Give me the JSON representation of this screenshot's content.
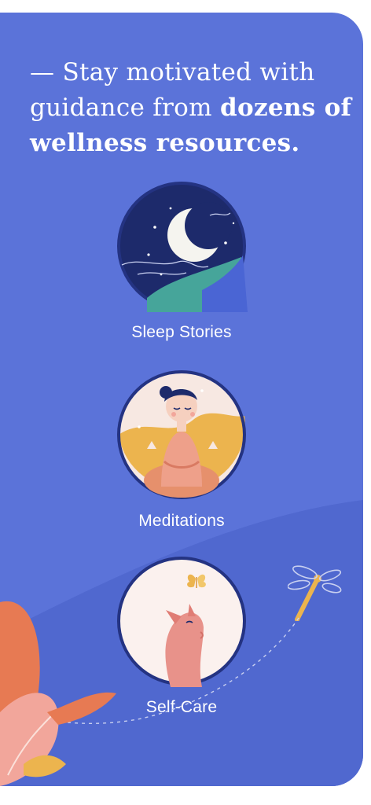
{
  "headline": {
    "prefix": "— Stay motivated with guidance from",
    "bold": "dozens of wellness resources."
  },
  "features": [
    {
      "label": "Sleep Stories",
      "icon": "moon-night-icon"
    },
    {
      "label": "Meditations",
      "icon": "meditating-person-icon"
    },
    {
      "label": "Self-Care",
      "icon": "dog-butterfly-icon"
    }
  ],
  "colors": {
    "background": "#5b73d9",
    "text": "#ffffff",
    "night": "#1d2a6b",
    "meditation_gold": "#ecb44e",
    "selfcare_pink": "#e8928a",
    "leaf_orange": "#e77a53"
  }
}
